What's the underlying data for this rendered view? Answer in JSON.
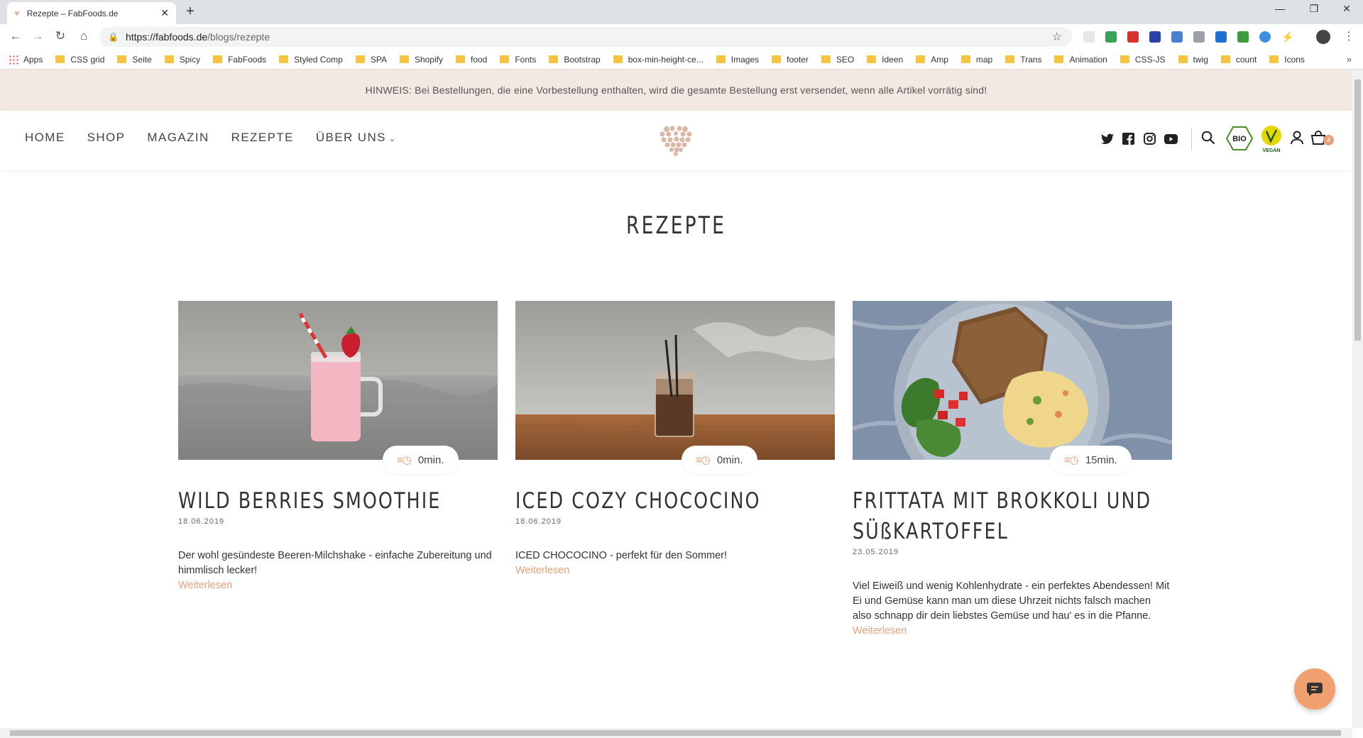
{
  "browser": {
    "tab_title": "Rezepte – FabFoods.de",
    "tab_close": "✕",
    "new_tab": "+",
    "url_host": "https://fabfoods.de",
    "url_path": "/blogs/rezepte",
    "bookmarks": [
      "Apps",
      "CSS grid",
      "Seite",
      "Spicy",
      "FabFoods",
      "Styled Comp",
      "SPA",
      "Shopify",
      "food",
      "Fonts",
      "Bootstrap",
      "box-min-height-ce...",
      "Images",
      "footer",
      "SEO",
      "Ideen",
      "Amp",
      "map",
      "Trans",
      "Animation",
      "CSS-JS",
      "twig",
      "count",
      "Icons"
    ]
  },
  "notice": "HINWEIS: Bei Bestellungen, die eine Vorbestellung enthalten, wird die gesamte Bestellung erst versendet, wenn alle Artikel vorrätig sind!",
  "nav": {
    "home": "HOME",
    "shop": "SHOP",
    "magazin": "MAGAZIN",
    "rezepte": "REZEPTE",
    "ueber_uns": "ÜBER UNS"
  },
  "cart_count": "4",
  "page_title": "REZEPTE",
  "recipes": [
    {
      "title": "WILD BERRIES SMOOTHIE",
      "date": "18.06.2019",
      "time": "0min.",
      "excerpt": "Der wohl gesündeste Beeren-Milchshake - einfache Zubereitung und himmlisch lecker!",
      "more": "Weiterlesen"
    },
    {
      "title": "ICED COZY CHOCOCINO",
      "date": "18.06.2019",
      "time": "0min.",
      "excerpt": "ICED CHOCOCINO - perfekt für den Sommer!",
      "more": "Weiterlesen"
    },
    {
      "title": "FRITTATA MIT BROKKOLI UND SÜßKARTOFFEL",
      "date": "23.05.2019",
      "time": "15min.",
      "excerpt": "Viel Eiweiß und wenig Kohlenhydrate - ein perfektes Abendessen! Mit Ei und Gemüse kann man um diese Uhrzeit nichts falsch machen also schnapp dir dein liebstes Gemüse und hau' es in die Pfanne.",
      "more": "Weiterlesen"
    }
  ],
  "colors": {
    "accent": "#e8a07a",
    "notice_bg": "#f3e8e2"
  }
}
